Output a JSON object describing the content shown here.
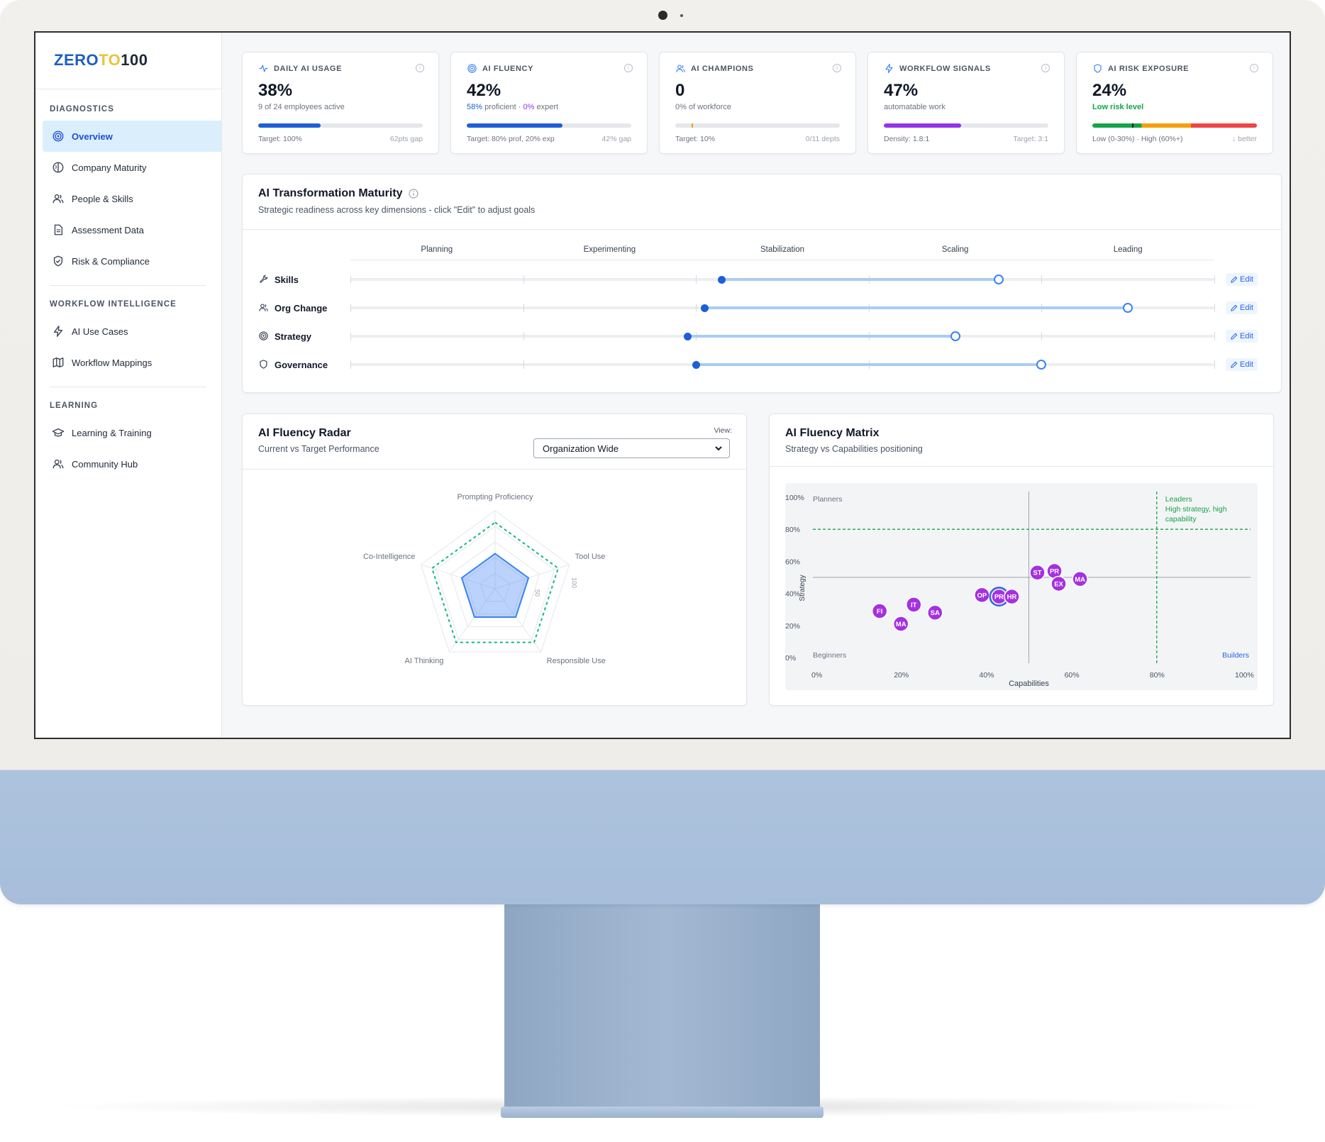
{
  "app": {
    "logo": {
      "part1": "ZERO",
      "part2": "TO",
      "part3": "100"
    }
  },
  "sidebar": {
    "sections": [
      {
        "heading": "DIAGNOSTICS",
        "items": [
          {
            "label": "Overview",
            "icon": "target-icon",
            "active": true
          },
          {
            "label": "Company Maturity",
            "icon": "brain-icon"
          },
          {
            "label": "People & Skills",
            "icon": "users-icon"
          },
          {
            "label": "Assessment Data",
            "icon": "file-text-icon"
          },
          {
            "label": "Risk & Compliance",
            "icon": "shield-check-icon"
          }
        ]
      },
      {
        "heading": "WORKFLOW INTELLIGENCE",
        "items": [
          {
            "label": "AI Use Cases",
            "icon": "zap-icon"
          },
          {
            "label": "Workflow Mappings",
            "icon": "map-icon"
          }
        ]
      },
      {
        "heading": "LEARNING",
        "items": [
          {
            "label": "Learning & Training",
            "icon": "graduation-cap-icon"
          },
          {
            "label": "Community Hub",
            "icon": "users-icon"
          }
        ]
      }
    ]
  },
  "kpis": [
    {
      "title": "DAILY AI USAGE",
      "icon": "activity-icon",
      "value": "38%",
      "sub": "9 of 24 employees active",
      "progress": 0.38,
      "bar_color": "#1d5fd6",
      "target": "Target: 100%",
      "gap": "62pts gap"
    },
    {
      "title": "AI FLUENCY",
      "icon": "target-icon",
      "value": "42%",
      "sub_a": "58%",
      "sub_b": " proficient · ",
      "sub_c": "0%",
      "sub_d": " expert",
      "progress": 0.58,
      "bar_color": "#1d5fd6",
      "target": "Target: 80% prof, 20% exp",
      "gap": "42% gap"
    },
    {
      "title": "AI CHAMPIONS",
      "icon": "users-icon",
      "value": "0",
      "sub": "0% of workforce",
      "progress": 0.0,
      "marker": 0.1,
      "target": "Target: 10%",
      "gap": "0/11 depts"
    },
    {
      "title": "WORKFLOW SIGNALS",
      "icon": "zap-icon",
      "value": "47%",
      "sub": "automatable work",
      "progress": 0.47,
      "bar_color": "#9333ea",
      "target": "Density: 1.8:1",
      "gap": "Target: 3:1"
    },
    {
      "title": "AI RISK EXPOSURE",
      "icon": "shield-icon",
      "value": "24%",
      "sub": "Low risk level",
      "progress": 0.24,
      "target": "Low (0-30%) · High (60%+)",
      "gap": "↓ better"
    }
  ],
  "colors": {
    "accent": "#1d5fd6",
    "purple": "#9333ea",
    "green": "#16a34a",
    "orange": "#f59e0b",
    "red": "#ef4444"
  },
  "maturity": {
    "title": "AI Transformation Maturity",
    "subtitle": "Strategic readiness across key dimensions - click \"Edit\" to adjust goals",
    "stages": [
      "Planning",
      "Experimenting",
      "Stabilization",
      "Scaling",
      "Leading"
    ],
    "edit_label": "Edit",
    "dimensions": [
      {
        "name": "Skills",
        "icon": "wrench-icon",
        "current": 2.15,
        "target": 3.75
      },
      {
        "name": "Org Change",
        "icon": "users-icon",
        "current": 2.05,
        "target": 4.5
      },
      {
        "name": "Strategy",
        "icon": "target-icon",
        "current": 1.95,
        "target": 3.5
      },
      {
        "name": "Governance",
        "icon": "shield-icon",
        "current": 2.0,
        "target": 4.0
      }
    ]
  },
  "radar": {
    "title": "AI Fluency Radar",
    "subtitle": "Current vs Target Performance",
    "view_label": "View:",
    "selected_view": "Organization Wide",
    "tick_labels": [
      "50",
      "100"
    ]
  },
  "chart_data": [
    {
      "type": "radar",
      "axes": [
        "Prompting Proficiency",
        "Tool Use",
        "Responsible Use",
        "AI Thinking",
        "Co-Intelligence"
      ],
      "range": [
        0,
        100
      ],
      "series": [
        {
          "values": [
            45,
            45,
            45,
            45,
            45
          ],
          "color": "#3b82f6"
        },
        {
          "values": [
            85,
            85,
            85,
            85,
            85
          ],
          "color": "#10b981"
        }
      ]
    },
    {
      "type": "scatter",
      "title": "AI Fluency Matrix",
      "subtitle": "Strategy vs Capabilities positioning",
      "xlabel": "Capabilities",
      "ylabel": "Strategy",
      "xlim": [
        0,
        100
      ],
      "ylim": [
        0,
        100
      ],
      "x_ticks": [
        "0%",
        "20%",
        "40%",
        "60%",
        "80%",
        "100%"
      ],
      "y_ticks": [
        "0%",
        "20%",
        "40%",
        "60%",
        "80%",
        "100%"
      ],
      "quadrants": {
        "top_left": "Planners",
        "bottom_left": "Beginners",
        "bottom_right": "Builders",
        "top_right": "Leaders",
        "top_right_desc": "High strategy, high capability"
      },
      "threshold": {
        "x": 80,
        "y": 80
      },
      "midlines": {
        "x": 50,
        "y": 50
      },
      "points": [
        {
          "label": "FI",
          "x": 15,
          "y": 29
        },
        {
          "label": "MA",
          "x": 20,
          "y": 21
        },
        {
          "label": "IT",
          "x": 23,
          "y": 33
        },
        {
          "label": "SA",
          "x": 28,
          "y": 28
        },
        {
          "label": "OP",
          "x": 39,
          "y": 39
        },
        {
          "label": "",
          "x": 43,
          "y": 38
        },
        {
          "label": "PR",
          "x": 43,
          "y": 38
        },
        {
          "label": "HR",
          "x": 46,
          "y": 38
        },
        {
          "label": "ST",
          "x": 52,
          "y": 53
        },
        {
          "label": "PR",
          "x": 56,
          "y": 54
        },
        {
          "label": "EX",
          "x": 57,
          "y": 46
        },
        {
          "label": "MA",
          "x": 62,
          "y": 49
        }
      ]
    }
  ]
}
